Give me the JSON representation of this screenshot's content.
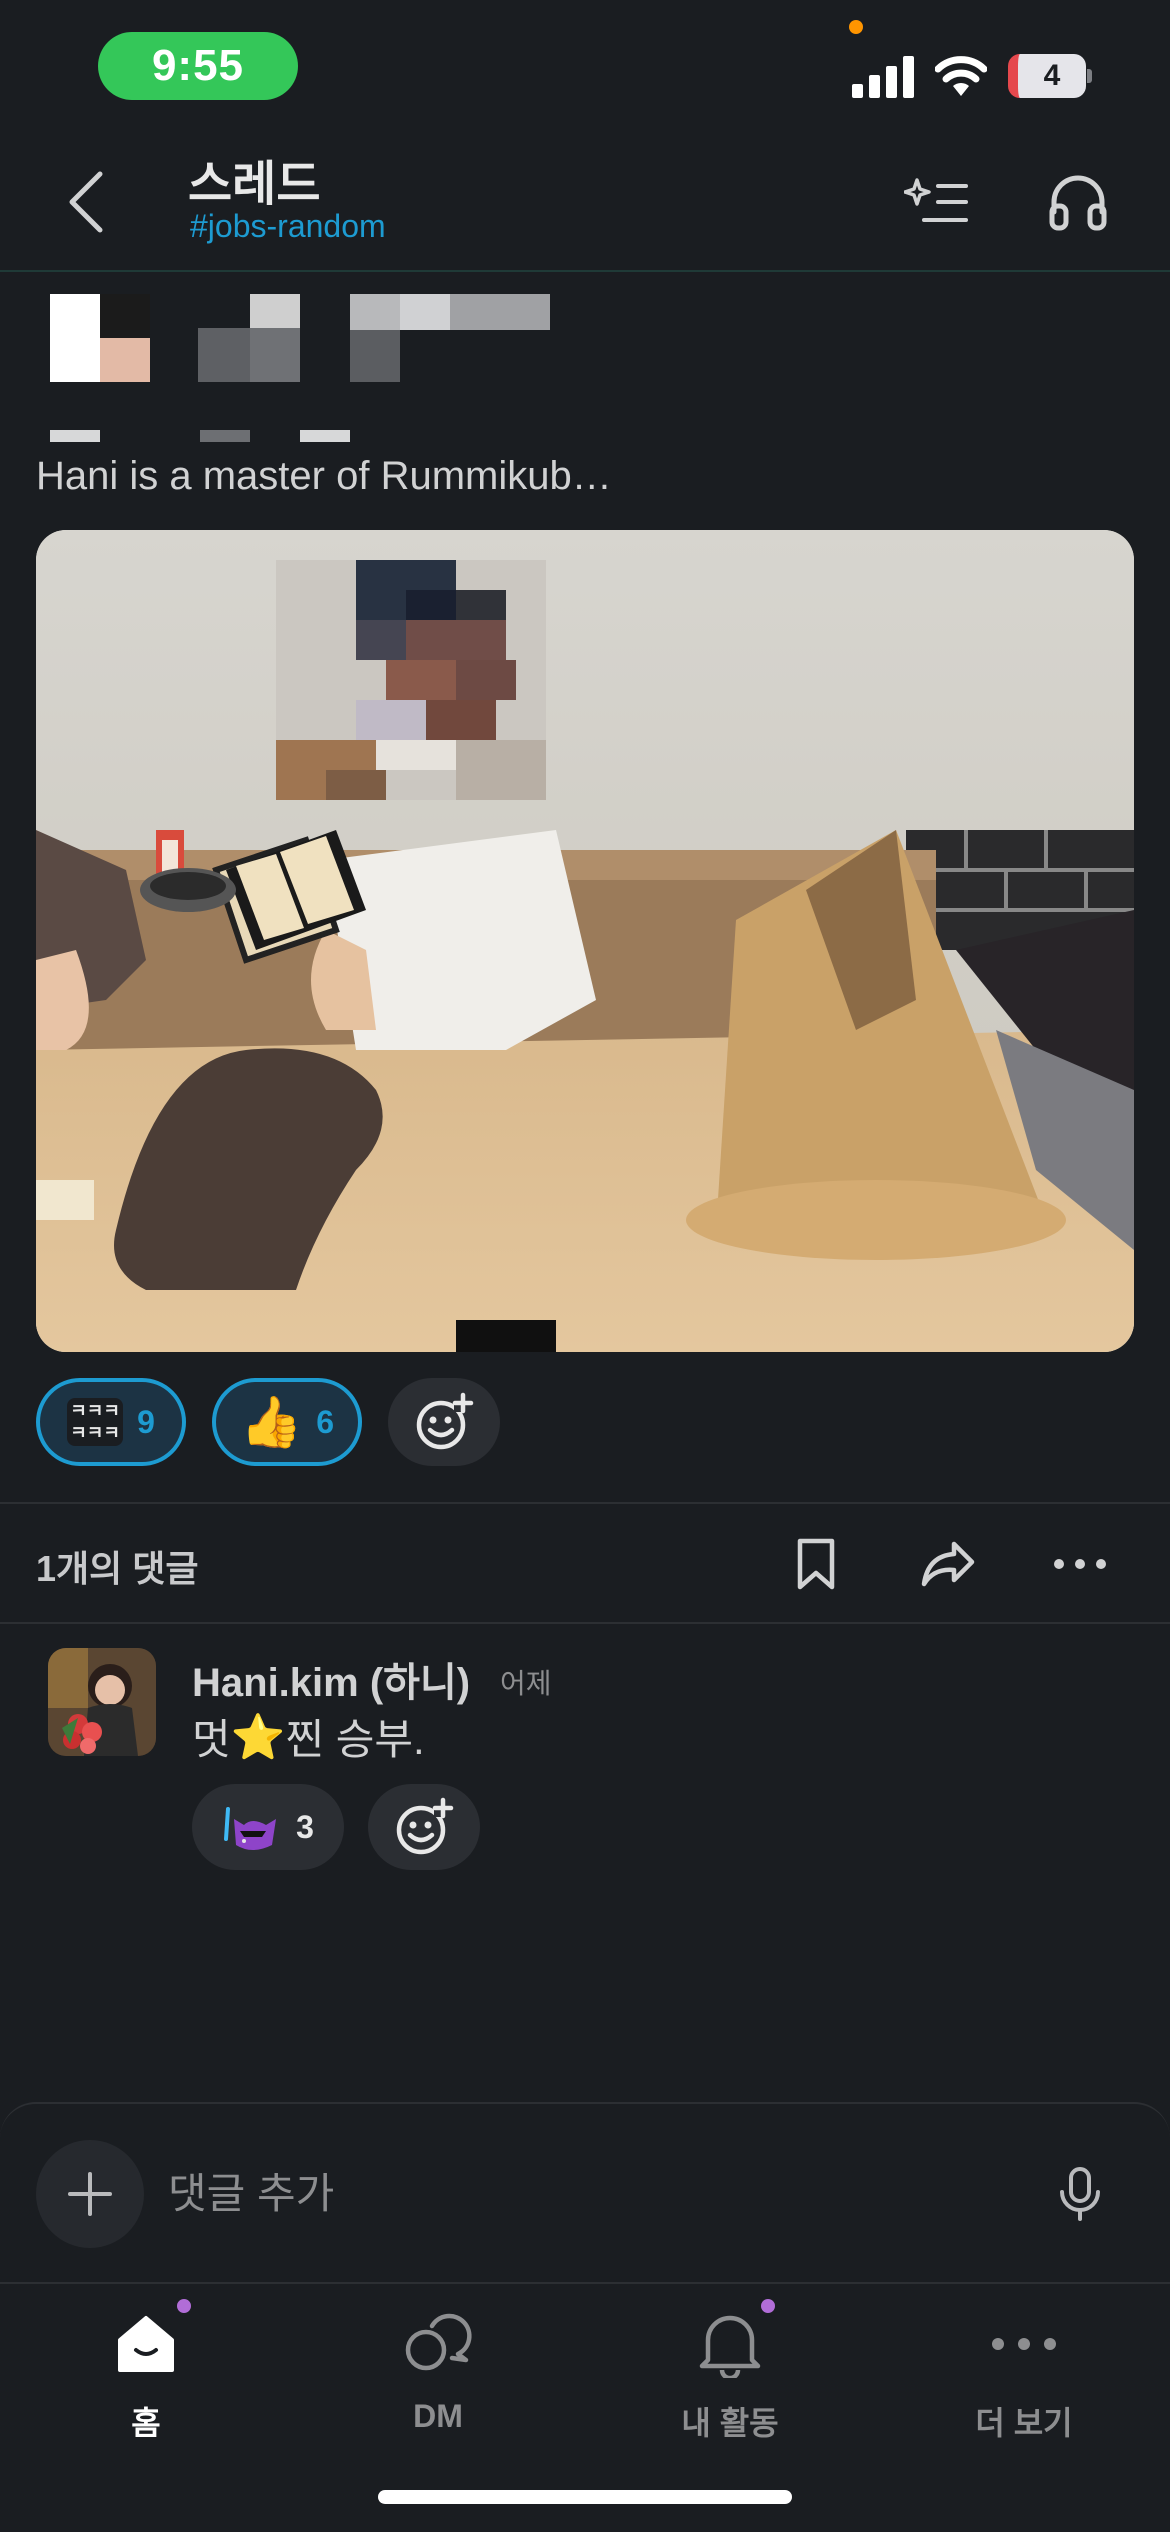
{
  "status_bar": {
    "time": "9:55",
    "battery": "4"
  },
  "header": {
    "title": "스레드",
    "channel": "#jobs-random"
  },
  "message": {
    "text": "Hani is a master of Rummikub…"
  },
  "reactions": [
    {
      "emoji": "ㅋㅋㅋ\nㅋㅋㅋ",
      "count": "9"
    },
    {
      "emoji": "👍",
      "count": "6"
    }
  ],
  "thread_bar": {
    "reply_count": "1개의 댓글"
  },
  "reply": {
    "name": "Hani.kim (하니)",
    "time": "어제",
    "text_before": "멋",
    "text_emoji": "⭐",
    "text_after": "찐 승부.",
    "reaction_count": "3"
  },
  "composer": {
    "placeholder": "댓글 추가"
  },
  "tabs": [
    {
      "label": "홈"
    },
    {
      "label": "DM"
    },
    {
      "label": "내 활동"
    },
    {
      "label": "더 보기"
    }
  ],
  "colors": {
    "accent": "#1d9bd1",
    "badge": "#b16dd7",
    "time_pill": "#34c759"
  }
}
